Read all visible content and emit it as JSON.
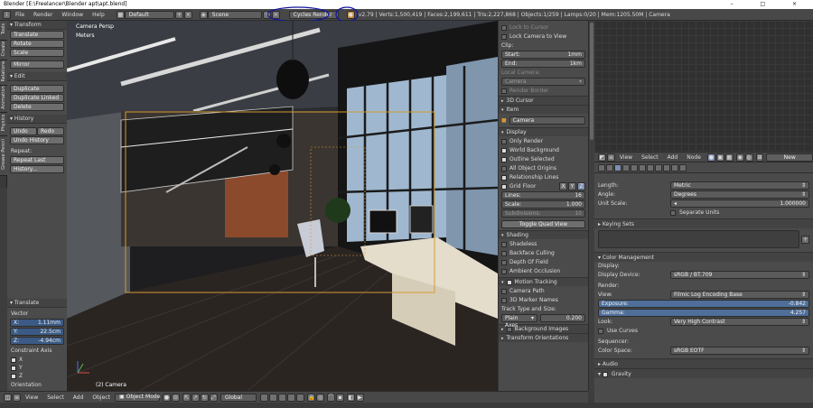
{
  "window": {
    "title": "Blender [E:\\Freelancer\\Blender apt\\apt.blend]",
    "controls": [
      "–",
      "□",
      "×"
    ]
  },
  "info_header": {
    "menus": [
      "File",
      "Render",
      "Window",
      "Help"
    ],
    "layout": "Default",
    "scene": "Scene",
    "engine": "Cycles Render",
    "stats": "v2.79 | Verts:1,500,419 | Faces:2,199,611 | Tris:2,227,868 | Objects:1/259 | Lamps:0/20 | Mem:1205.50M | Camera"
  },
  "left_tabs": [
    "Tools",
    "Create",
    "Relations",
    "Animation",
    "Physics",
    "Grease Pencil"
  ],
  "toolshelf": {
    "transform": {
      "header": "Transform",
      "buttons": [
        "Translate",
        "Rotate",
        "Scale",
        "Mirror"
      ]
    },
    "edit": {
      "header": "Edit",
      "buttons": [
        "Duplicate",
        "Duplicate Linked",
        "Delete"
      ]
    },
    "history": {
      "header": "History",
      "undo": "Undo",
      "redo": "Redo",
      "undo_history": "Undo History",
      "repeat_label": "Repeat:",
      "repeat_last": "Repeat Last",
      "history_btn": "History..."
    }
  },
  "operator": {
    "header": "Translate",
    "vector_label": "Vector",
    "x": "1.11mm",
    "y": "22.5cm",
    "z": "-4.94cm",
    "constraint_label": "Constraint Axis",
    "axes": [
      "X",
      "Y",
      "Z"
    ],
    "orientation": "Orientation"
  },
  "viewport": {
    "view_name": "Camera Persp",
    "units": "Meters",
    "object_label": "(2) Camera"
  },
  "view_header": {
    "menus": [
      "View",
      "Select",
      "Add",
      "Object"
    ],
    "mode": "Object Mode",
    "orientation": "Global"
  },
  "npanel": {
    "lock_to_cursor": "Lock to Cursor",
    "lock_camera_to_view": "Lock Camera to View",
    "clip_label": "Clip:",
    "clip_start_label": "Start:",
    "clip_start": "1mm",
    "clip_end_label": "End:",
    "clip_end": "1km",
    "local_camera_label": "Local Camera:",
    "local_camera": "Camera",
    "render_border": "Render Border",
    "cursor_header": "3D Cursor",
    "item_header": "Item",
    "item_name": "Camera",
    "display_header": "Display",
    "only_render": "Only Render",
    "world_background": "World Background",
    "outline_selected": "Outline Selected",
    "all_object_origins": "All Object Origins",
    "relationship_lines": "Relationship Lines",
    "grid_floor": "Grid Floor",
    "grid_axes": [
      "X",
      "Y",
      "Z"
    ],
    "lines_label": "Lines:",
    "lines": "16",
    "scale_label": "Scale:",
    "scale": "1.000",
    "subdivisions_label": "Subdivisions:",
    "subdivisions": "10",
    "toggle_quad_view": "Toggle Quad View",
    "shading_header": "Shading",
    "shadeless": "Shadeless",
    "backface_culling": "Backface Culling",
    "depth_of_field": "Depth Of Field",
    "ambient_occlusion": "Ambient Occlusion",
    "motion_tracking_header": "Motion Tracking",
    "camera_path": "Camera Path",
    "marker_names": "3D Marker Names",
    "track_type_label": "Track Type and Size:",
    "track_type": "Plain Axes",
    "track_size": "0.200",
    "background_images_header": "Background Images",
    "transform_orientations_header": "Transform Orientations"
  },
  "node_header": {
    "menus": [
      "View",
      "Select",
      "Add",
      "Node"
    ],
    "new_button": "New"
  },
  "properties": {
    "length_label": "Length:",
    "length": "Metric",
    "angle_label": "Angle:",
    "angle": "Degrees",
    "unit_scale_label": "Unit Scale:",
    "unit_scale": "1.000000",
    "separate_units": "Separate Units",
    "keying_sets_header": "Keying Sets",
    "color_mgmt_header": "Color Management",
    "display_label": "Display:",
    "display_device_label": "Display Device:",
    "display_device": "sRGB / BT.709",
    "render_label": "Render:",
    "view_label": "View:",
    "view": "Filmic Log Encoding Base",
    "exposure_label": "Exposure:",
    "exposure": "-0.842",
    "gamma_label": "Gamma:",
    "gamma": "4.257",
    "look_label": "Look:",
    "look": "Very High Contrast",
    "use_curves": "Use Curves",
    "sequencer_label": "Sequencer:",
    "color_space_label": "Color Space:",
    "color_space": "sRGB EOTF",
    "audio_header": "Audio",
    "gravity_header": "Gravity"
  },
  "colors": {
    "annotation": "#1515a0",
    "selection": "#d39a32",
    "panel": "#4b4b4b"
  }
}
